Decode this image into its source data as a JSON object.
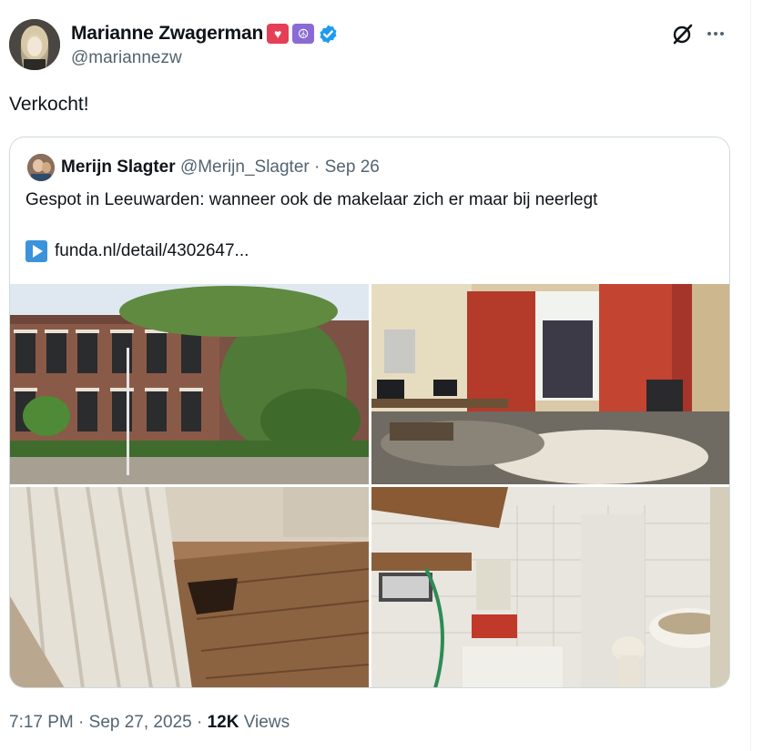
{
  "author": {
    "display_name": "Marianne Zwagerman",
    "handle": "@mariannezw",
    "badges": [
      "heart-emoji",
      "peace-emoji",
      "verified-badge"
    ],
    "badge_glyphs": {
      "heart": "♥",
      "peace": "☮"
    }
  },
  "tweet": {
    "text": "Verkocht!",
    "time": "7:17 PM",
    "sep": " · ",
    "date": "Sep 27, 2025",
    "views_count": "12K",
    "views_label": " Views"
  },
  "quoted": {
    "display_name": "Merijn Slagter",
    "handle": "@Merijn_Slagter",
    "sep": " · ",
    "date": "Sep 26",
    "text": "Gespot in Leeuwarden: wanneer ook de makelaar zich er maar bij neerlegt",
    "link": "funda.nl/detail/4302647..."
  },
  "photos": [
    {
      "subject": "brick-row-house-exterior"
    },
    {
      "subject": "messy-bedroom-with-red-curtains"
    },
    {
      "subject": "damaged-wooden-floor"
    },
    {
      "subject": "dirty-kitchen-and-bathroom"
    }
  ],
  "colors": {
    "text": "#0f1419",
    "secondary": "#536471",
    "border": "#cfd9de",
    "verified": "#1d9bf0",
    "heart_badge": "#e53e56",
    "peace_badge": "#8a6bd6",
    "link_icon": "#3b94d9"
  }
}
